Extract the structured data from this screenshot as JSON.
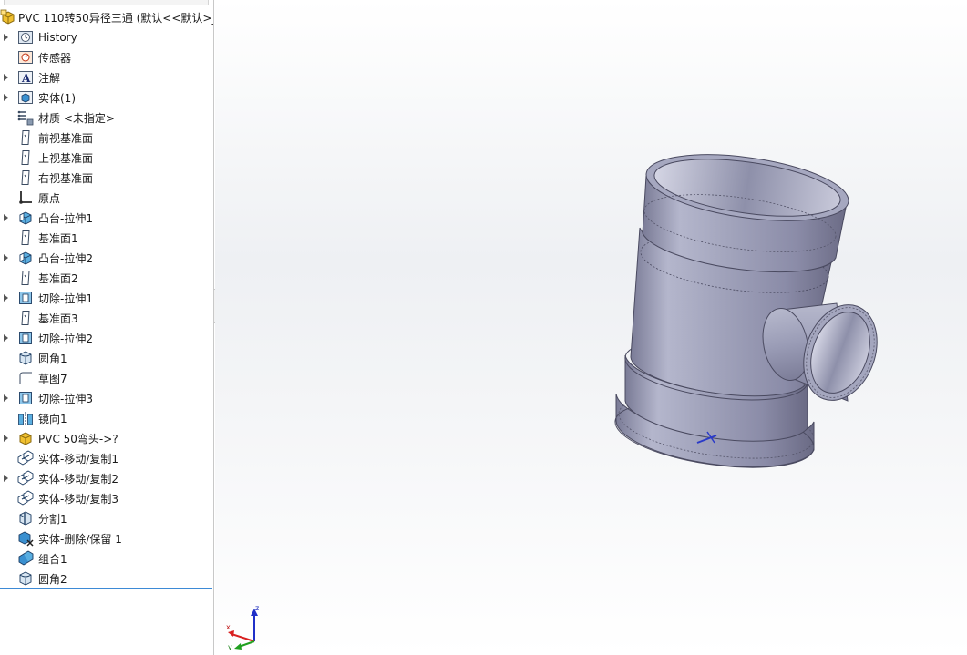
{
  "feature_tree": {
    "root": {
      "label": "PVC 110转50异径三通  (默认<<默认>_",
      "icon": "part-icon"
    },
    "items": [
      {
        "label": "History",
        "icon": "history-icon",
        "expandable": true
      },
      {
        "label": "传感器",
        "icon": "sensor-icon",
        "expandable": false
      },
      {
        "label": "注解",
        "icon": "annotation-icon",
        "expandable": true
      },
      {
        "label": "实体(1)",
        "icon": "solid-bodies-icon",
        "expandable": true
      },
      {
        "label": "材质 <未指定>",
        "icon": "material-icon",
        "expandable": false
      },
      {
        "label": "前视基准面",
        "icon": "plane-icon",
        "expandable": false
      },
      {
        "label": "上视基准面",
        "icon": "plane-icon",
        "expandable": false
      },
      {
        "label": "右视基准面",
        "icon": "plane-icon",
        "expandable": false
      },
      {
        "label": "原点",
        "icon": "origin-icon",
        "expandable": false
      },
      {
        "label": "凸台-拉伸1",
        "icon": "boss-extrude-icon",
        "expandable": true
      },
      {
        "label": "基准面1",
        "icon": "plane-icon",
        "expandable": false
      },
      {
        "label": "凸台-拉伸2",
        "icon": "boss-extrude-icon",
        "expandable": true
      },
      {
        "label": "基准面2",
        "icon": "plane-icon",
        "expandable": false
      },
      {
        "label": "切除-拉伸1",
        "icon": "cut-extrude-icon",
        "expandable": true
      },
      {
        "label": "基准面3",
        "icon": "plane-icon",
        "expandable": false
      },
      {
        "label": "切除-拉伸2",
        "icon": "cut-extrude-icon",
        "expandable": true
      },
      {
        "label": "圆角1",
        "icon": "fillet-icon",
        "expandable": false
      },
      {
        "label": "草图7",
        "icon": "sketch-icon",
        "expandable": false
      },
      {
        "label": "切除-拉伸3",
        "icon": "cut-extrude-icon",
        "expandable": true
      },
      {
        "label": "镜向1",
        "icon": "mirror-icon",
        "expandable": false
      },
      {
        "label": "PVC 50弯头->?",
        "icon": "part-icon",
        "expandable": true
      },
      {
        "label": "实体-移动/复制1",
        "icon": "move-copy-icon",
        "expandable": false
      },
      {
        "label": "实体-移动/复制2",
        "icon": "move-copy-icon",
        "expandable": true
      },
      {
        "label": "实体-移动/复制3",
        "icon": "move-copy-icon",
        "expandable": false
      },
      {
        "label": "分割1",
        "icon": "split-icon",
        "expandable": false
      },
      {
        "label": "实体-删除/保留 1",
        "icon": "delete-body-icon",
        "expandable": false
      },
      {
        "label": "组合1",
        "icon": "combine-icon",
        "expandable": false
      },
      {
        "label": "圆角2",
        "icon": "fillet-icon",
        "expandable": false
      }
    ]
  },
  "triad": {
    "z_label": "z",
    "x_label": "x",
    "y_label": "y"
  },
  "colors": {
    "part_body": "#9a9bb8",
    "tree_selection_bar": "#3d8ad6",
    "triad_x": "#d92020",
    "triad_y": "#20a020",
    "triad_z": "#2030c8"
  }
}
